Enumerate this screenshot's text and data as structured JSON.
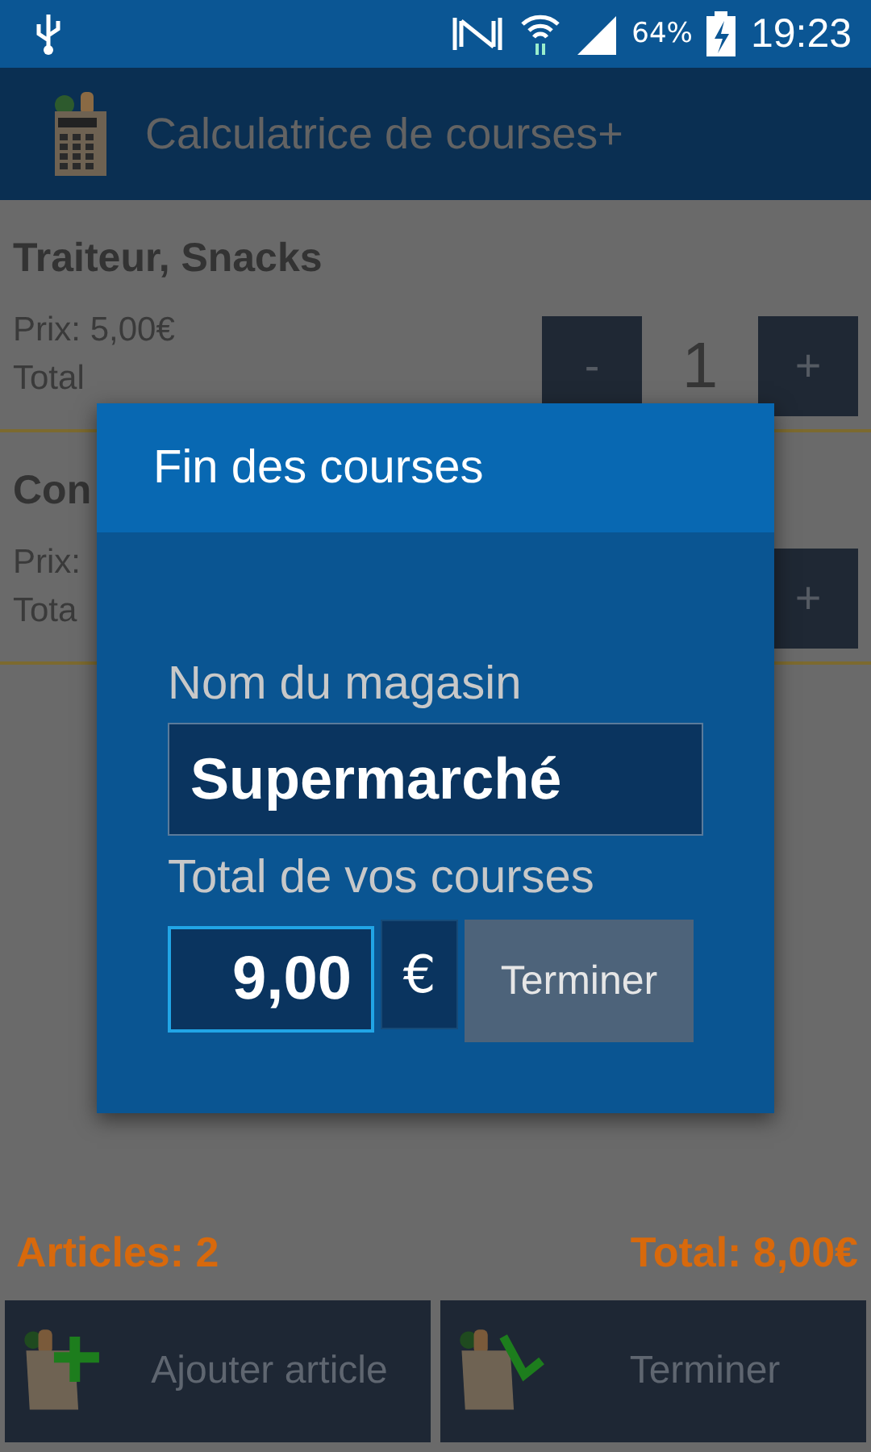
{
  "status_bar": {
    "battery": "64%",
    "time": "19:23"
  },
  "app_bar": {
    "title": "Calculatrice de courses+"
  },
  "items": [
    {
      "name": "Traiteur, Snacks",
      "price": "Prix: 5,00€",
      "total": "Total",
      "minus": "-",
      "quantity": "1",
      "plus": "+"
    },
    {
      "name": "Con",
      "price": "Prix:",
      "total": "Tota",
      "plus": "+"
    }
  ],
  "summary": {
    "articles": "Articles: 2",
    "total": "Total: 8,00€"
  },
  "bottom_buttons": [
    {
      "kind": "add",
      "label": "Ajouter article"
    },
    {
      "kind": "finish",
      "label": "Terminer"
    }
  ],
  "dialog": {
    "title": "Fin des courses",
    "store_label": "Nom du magasin",
    "store_value": "Supermarché",
    "total_label": "Total de vos courses",
    "total_value": "9,00",
    "currency": "€",
    "button": "Terminer"
  }
}
